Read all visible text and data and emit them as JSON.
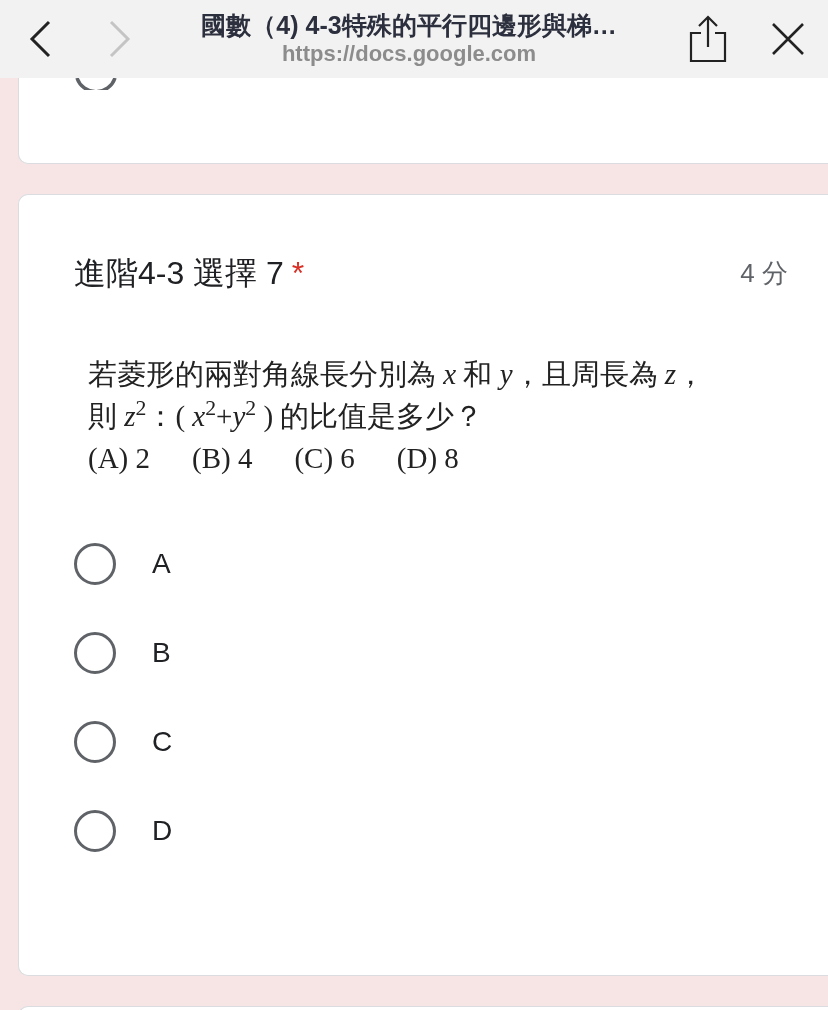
{
  "browser_bar": {
    "title": "國數（4) 4-3特殊的平行四邊形與梯…",
    "url": "https://docs.google.com",
    "back_disabled": false,
    "forward_disabled": true
  },
  "question": {
    "title": "進階4-3 選擇 7",
    "required_mark": "*",
    "points": "4 分",
    "body_lines": [
      "若菱形的兩對角線長分別為 *x* 和 *y*，且周長為 *z*，",
      "則 *z*$^{2}$：( *x*$^{2}$+*y*$^{2}$ ) 的比值是多少？"
    ],
    "choices_line": [
      "(A) 2",
      "(B) 4",
      "(C) 6",
      "(D) 8"
    ],
    "options": [
      {
        "label": "A",
        "selected": false
      },
      {
        "label": "B",
        "selected": false
      },
      {
        "label": "C",
        "selected": false
      },
      {
        "label": "D",
        "selected": false
      }
    ]
  }
}
